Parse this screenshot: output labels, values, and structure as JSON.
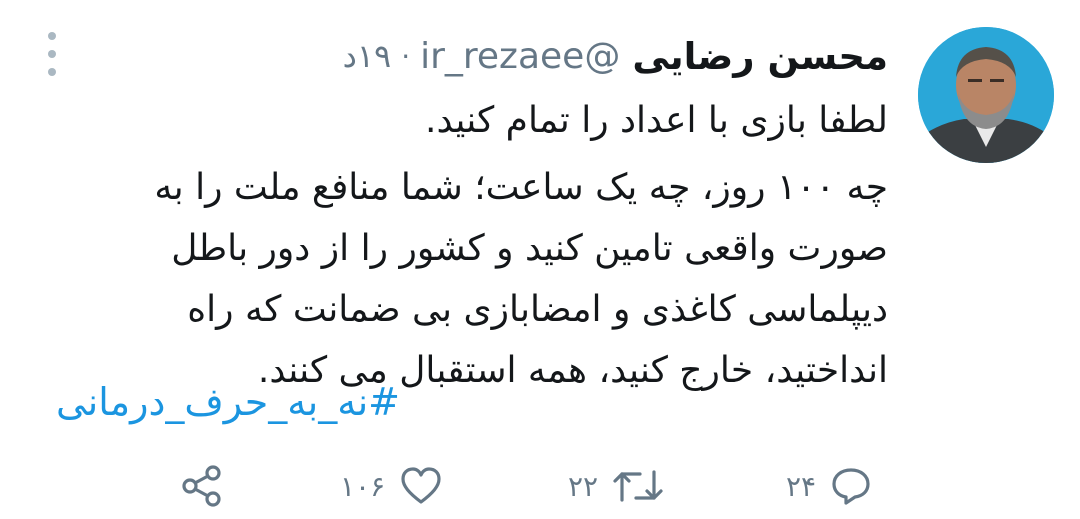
{
  "tweet": {
    "author_name": "محسن رضایی",
    "handle": "@ir_rezaee",
    "separator": "·",
    "time": "۱۹د",
    "lines": [
      "لطفا بازی با اعداد را تمام کنید.",
      "چه ۱۰۰ روز، چه یک ساعت؛ شما منافع ملت را به",
      "صورت واقعی تامین کنید و کشور را از دور باطل",
      "دیپلماسی کاغذی و امضابازی بی ضمانت که راه",
      "انداختید، خارج کنید، همه استقبال می کنند."
    ],
    "hashtag": "#نه_به_حرف_درمانی"
  },
  "actions": {
    "reply_count": "۲۴",
    "retweet_count": "۲۲",
    "like_count": "۱۰۶"
  },
  "colors": {
    "accent": "#1b95e0",
    "muted": "#657786",
    "avatar_bg": "#2aa7d8"
  },
  "icons": [
    "overflow-menu-icon",
    "reply-icon",
    "retweet-icon",
    "like-icon",
    "share-icon"
  ]
}
